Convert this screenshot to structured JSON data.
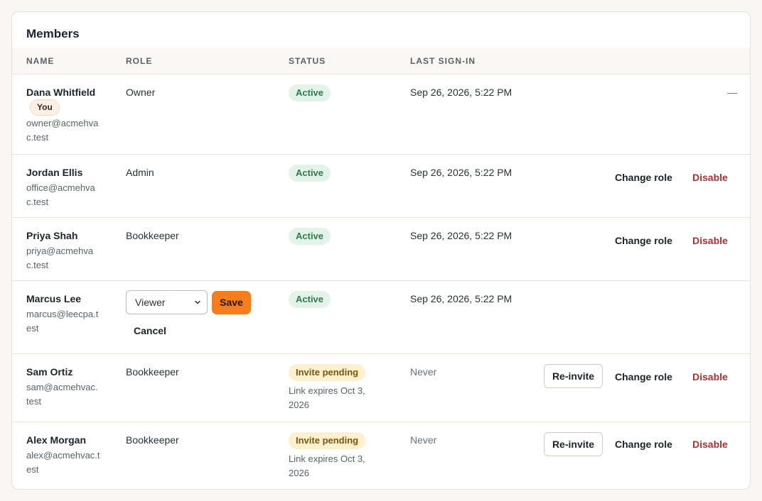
{
  "title": "Members",
  "columns": {
    "name": "NAME",
    "role": "ROLE",
    "status": "STATUS",
    "last_signin": "LAST SIGN-IN"
  },
  "actions": {
    "change_role": "Change role",
    "disable": "Disable",
    "reinvite": "Re-invite",
    "save": "Save",
    "cancel": "Cancel"
  },
  "members": [
    {
      "name": "Dana Whitfield",
      "badge": "You",
      "email": "owner@acmehvac.test",
      "role": "Owner",
      "status": "Active",
      "last_signin": "Sep 26, 2026, 5:22 PM",
      "actions_placeholder": "—"
    },
    {
      "name": "Jordan Ellis",
      "email": "office@acmehvac.test",
      "role": "Admin",
      "status": "Active",
      "last_signin": "Sep 26, 2026, 5:22 PM"
    },
    {
      "name": "Priya Shah",
      "email": "priya@acmehvac.test",
      "role": "Bookkeeper",
      "status": "Active",
      "last_signin": "Sep 26, 2026, 5:22 PM"
    },
    {
      "name": "Marcus Lee",
      "email": "marcus@leecpa.test",
      "role_select_value": "Viewer",
      "status": "Active",
      "last_signin": "Sep 26, 2026, 5:22 PM"
    },
    {
      "name": "Sam Ortiz",
      "email": "sam@acmehvac.test",
      "role": "Bookkeeper",
      "status": "Invite pending",
      "expires": "Link expires Oct 3, 2026",
      "last_signin": "Never"
    },
    {
      "name": "Alex Morgan",
      "email": "alex@acmehvac.test",
      "role": "Bookkeeper",
      "status": "Invite pending",
      "expires": "Link expires Oct 3, 2026",
      "last_signin": "Never"
    }
  ],
  "colors": {
    "active_bg": "#e4f3ea",
    "active_text": "#2f7a4d",
    "pending_bg": "#fdf0cf",
    "pending_text": "#7a5510",
    "disable_text": "#b03030",
    "save_bg": "#f57c1f"
  }
}
